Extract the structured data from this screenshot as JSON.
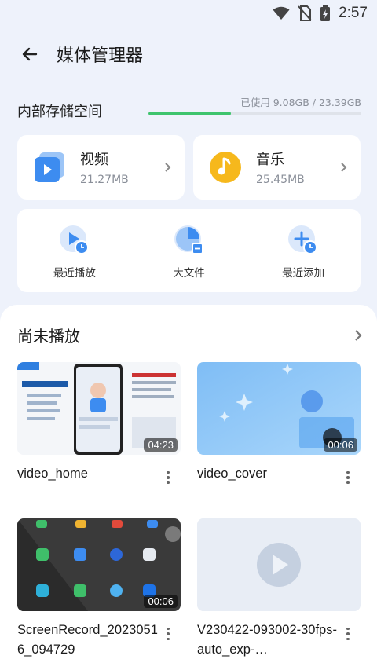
{
  "status_bar": {
    "time": "2:57"
  },
  "appbar": {
    "title": "媒体管理器"
  },
  "storage": {
    "label": "内部存储空间",
    "usage_text": "已使用 9.08GB / 23.39GB",
    "used_fraction": 0.388,
    "bar_color": "#3ec46d"
  },
  "categories": [
    {
      "name": "视频",
      "size": "21.27MB",
      "icon": "video-folder-icon",
      "color": "#3d8cf0"
    },
    {
      "name": "音乐",
      "size": "25.45MB",
      "icon": "music-note-icon",
      "color": "#f6b81c"
    }
  ],
  "quick_actions": [
    {
      "label": "最近播放",
      "icon": "recent-play-icon"
    },
    {
      "label": "大文件",
      "icon": "large-file-icon"
    },
    {
      "label": "最近添加",
      "icon": "recent-add-icon"
    }
  ],
  "unplayed": {
    "title": "尚未播放",
    "videos": [
      {
        "name": "video_home",
        "duration": "04:23"
      },
      {
        "name": "video_cover",
        "duration": "00:06"
      },
      {
        "name": "ScreenRecord_20230516_094729",
        "duration": "00:06"
      },
      {
        "name": "V230422-093002-30fps-auto_exp-…",
        "duration": ""
      }
    ]
  },
  "colors": {
    "accent": "#3d8cf0",
    "background": "#eef2fb"
  }
}
